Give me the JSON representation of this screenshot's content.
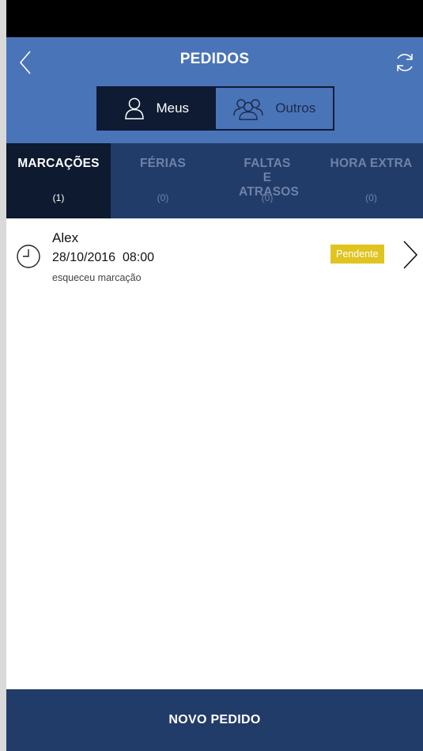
{
  "header": {
    "title": "PEDIDOS",
    "back_icon": "chevron-left-icon",
    "refresh_icon": "refresh-icon"
  },
  "segmented": {
    "options": [
      {
        "label": "Meus",
        "icon": "user-icon",
        "selected": true
      },
      {
        "label": "Outros",
        "icon": "users-group-icon",
        "selected": false
      }
    ]
  },
  "tabs": [
    {
      "label": "MARCAÇÕES",
      "count": "(1)",
      "active": true
    },
    {
      "label": "FÉRIAS",
      "count": "(0)",
      "active": false
    },
    {
      "label": "FALTAS E ATRASOS",
      "count": "(0)",
      "active": false
    },
    {
      "label": "HORA EXTRA",
      "count": "(0)",
      "active": false
    }
  ],
  "requests": [
    {
      "icon": "clock-icon",
      "name": "Alex",
      "datetime": "28/10/2016  08:00",
      "reason": "esqueceu marcação",
      "status": "Pendente"
    }
  ],
  "footer": {
    "button_label": "NOVO PEDIDO"
  },
  "colors": {
    "header_blue": "#4a74b8",
    "tab_bar": "#223c69",
    "active_tab": "#0d1a30",
    "badge_yellow": "#e0c420"
  }
}
